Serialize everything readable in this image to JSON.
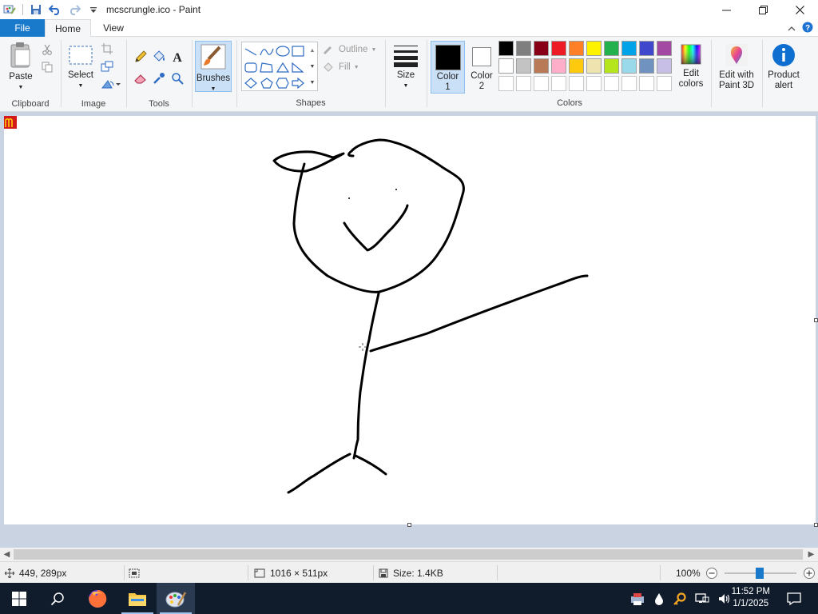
{
  "window": {
    "title": "mcscrungle.ico - Paint"
  },
  "tabs": {
    "file": "File",
    "home": "Home",
    "view": "View"
  },
  "ribbon": {
    "clipboard": {
      "paste": "Paste",
      "group": "Clipboard"
    },
    "image": {
      "select": "Select",
      "group": "Image"
    },
    "tools": {
      "group": "Tools"
    },
    "brushes": {
      "label": "Brushes"
    },
    "shapes": {
      "outline": "Outline",
      "fill": "Fill",
      "group": "Shapes"
    },
    "size": {
      "label": "Size"
    },
    "color1": {
      "label1": "Color",
      "label2": "1"
    },
    "color2": {
      "label1": "Color",
      "label2": "2"
    },
    "colors": {
      "group": "Colors"
    },
    "edit_colors": {
      "label1": "Edit",
      "label2": "colors"
    },
    "paint3d": {
      "label1": "Edit with",
      "label2": "Paint 3D"
    },
    "product_alert": {
      "label1": "Product",
      "label2": "alert"
    }
  },
  "palette_row1": [
    "#000000",
    "#7f7f7f",
    "#880015",
    "#ed1c24",
    "#ff7f27",
    "#fff200",
    "#22b14c",
    "#00a2e8",
    "#3f48cc",
    "#a349a4"
  ],
  "palette_row2": [
    "#ffffff",
    "#c3c3c3",
    "#b97a57",
    "#ffaec9",
    "#ffc90e",
    "#efe4b0",
    "#b5e61d",
    "#99d9ea",
    "#7092be",
    "#c8bfe7"
  ],
  "palette_row3": [
    "#ffffff",
    "#ffffff",
    "#ffffff",
    "#ffffff",
    "#ffffff",
    "#ffffff",
    "#ffffff",
    "#ffffff",
    "#ffffff",
    "#ffffff"
  ],
  "colors": {
    "color1": "#000000",
    "color2": "#ffffff",
    "file_tab": "#1979ca",
    "workspace": "#cad3e1",
    "taskbar": "#101c2c"
  },
  "status": {
    "cursor_pos": "449, 289px",
    "selection": "",
    "canvas_size": "1016 × 511px",
    "file_size": "Size: 1.4KB",
    "zoom": "100%"
  },
  "taskbar": {
    "time": "11:52 PM",
    "date": "1/1/2025"
  }
}
